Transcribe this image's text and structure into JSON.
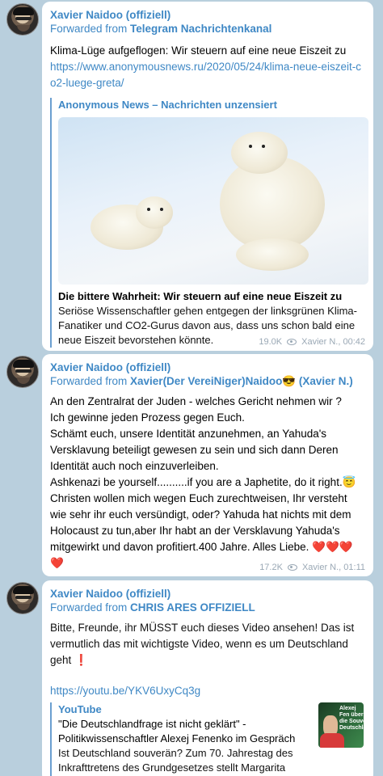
{
  "messages": [
    {
      "sender": "Xavier Naidoo (offiziell)",
      "forwarded_prefix": "Forwarded from ",
      "forwarded_from": "Telegram Nachrichtenkanal",
      "text": "Klima-Lüge aufgeflogen: Wir steuern auf eine neue Eiszeit zu",
      "link": "https://www.anonymousnews.ru/2020/05/24/klima-neue-eiszeit-co2-luege-greta/",
      "preview": {
        "site": "Anonymous News – Nachrichten unzensiert",
        "title": "Die bittere Wahrheit: Wir steuern auf eine neue Eiszeit zu",
        "description": "Seriöse Wissenschaftler gehen entgegen der linksgrünen Klima-Fanatiker und CO2-Gurus davon aus, dass uns schon bald eine neue Eiszeit bevorstehen könnte."
      },
      "views": "19.0K",
      "author_time": "Xavier N., 00:42"
    },
    {
      "sender": "Xavier Naidoo (offiziell)",
      "forwarded_prefix": "Forwarded from ",
      "forwarded_from": "Xavier(Der VereiNiger)Naidoo😎 (Xavier N.)",
      "lines": [
        "An den Zentralrat der Juden - welches Gericht nehmen wir ?",
        "Ich gewinne jeden Prozess gegen Euch.",
        "Schämt euch, unsere Identität anzunehmen, an Yahuda's Versklavung beteiligt gewesen zu sein und sich dann Deren Identität auch noch einzuverleiben.",
        "Ashkenazi be yourself..........if you are a Japhetite, do it right.😇",
        "Christen wollen mich wegen Euch zurechtweisen, Ihr versteht wie sehr ihr euch versündigt, oder? Yahuda hat nichts mit dem Holocaust zu tun,aber Ihr habt an der Versklavung Yahuda's mitgewirkt und davon profitiert.400 Jahre. Alles Liebe. ❤️❤️❤️❤️"
      ],
      "views": "17.2K",
      "author_time": "Xavier N., 01:11"
    },
    {
      "sender": "Xavier Naidoo (offiziell)",
      "forwarded_prefix": "Forwarded from ",
      "forwarded_from": "CHRIS ARES OFFIZIELL",
      "text": "Bitte, Freunde, ihr MÜSST euch dieses Video ansehen! Das ist vermutlich das mit wichtigste Video, wenn es um Deutschland geht ❗",
      "link": "https://youtu.be/YKV6UxyCq3g",
      "preview": {
        "site": "YouTube",
        "title": "\"Die Deutschlandfrage ist nicht geklärt\" - Politikwissenschaftler Alexej Fenenko im Gespräch",
        "description": "Ist Deutschland souverän? Zum 70. Jahrestag des Inkrafttretens des Grundgesetzes stellt Margarita Bityutski diese",
        "thumb_text": "Alexej Fen über die Souve Deutschla"
      }
    }
  ]
}
